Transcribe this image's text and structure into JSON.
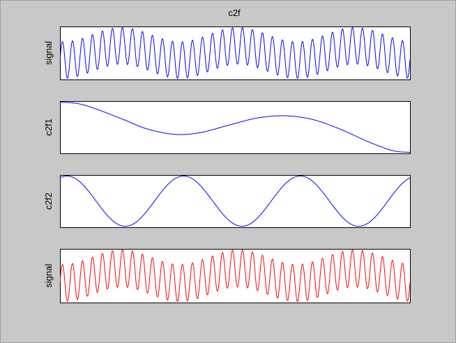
{
  "figure": {
    "title": "c2f",
    "background": "#c8c8c8"
  },
  "chart_data": [
    {
      "type": "line",
      "title": "c2f",
      "ylabel": "signal",
      "xlabel": "",
      "ticks_visible": false,
      "series": [
        {
          "color": "#0000ff",
          "components": [
            {
              "kind": "oscillation",
              "cycles": 35,
              "amplitude": 0.72
            },
            {
              "kind": "modulation",
              "cycles": 3,
              "amplitude": 0.28,
              "phase_deg": -100
            }
          ]
        }
      ]
    },
    {
      "type": "line",
      "title": "",
      "ylabel": "c2f1",
      "xlabel": "",
      "ticks_visible": false,
      "series": [
        {
          "color": "#0000ff",
          "points": [
            [
              0.0,
              0.7
            ],
            [
              0.05,
              0.66
            ],
            [
              0.1,
              0.52
            ],
            [
              0.18,
              0.22
            ],
            [
              0.25,
              -0.05
            ],
            [
              0.33,
              -0.2
            ],
            [
              0.4,
              -0.15
            ],
            [
              0.48,
              0.05
            ],
            [
              0.56,
              0.25
            ],
            [
              0.64,
              0.32
            ],
            [
              0.72,
              0.22
            ],
            [
              0.8,
              -0.05
            ],
            [
              0.88,
              -0.4
            ],
            [
              0.95,
              -0.65
            ],
            [
              1.0,
              -0.7
            ]
          ]
        }
      ]
    },
    {
      "type": "line",
      "title": "",
      "ylabel": "c2f2",
      "xlabel": "",
      "ticks_visible": false,
      "series": [
        {
          "color": "#0000ff",
          "components": [
            {
              "kind": "oscillation",
              "cycles": 3,
              "amplitude": 1.0,
              "phase_deg": 0,
              "start": 0.02,
              "ramp": 0.04
            }
          ]
        }
      ]
    },
    {
      "type": "line",
      "title": "",
      "ylabel": "signal",
      "xlabel": "",
      "ticks_visible": false,
      "series": [
        {
          "color": "#ff0000",
          "components": [
            {
              "kind": "oscillation",
              "cycles": 35,
              "amplitude": 0.72
            },
            {
              "kind": "modulation",
              "cycles": 3,
              "amplitude": 0.28,
              "phase_deg": -100
            }
          ]
        }
      ]
    }
  ]
}
